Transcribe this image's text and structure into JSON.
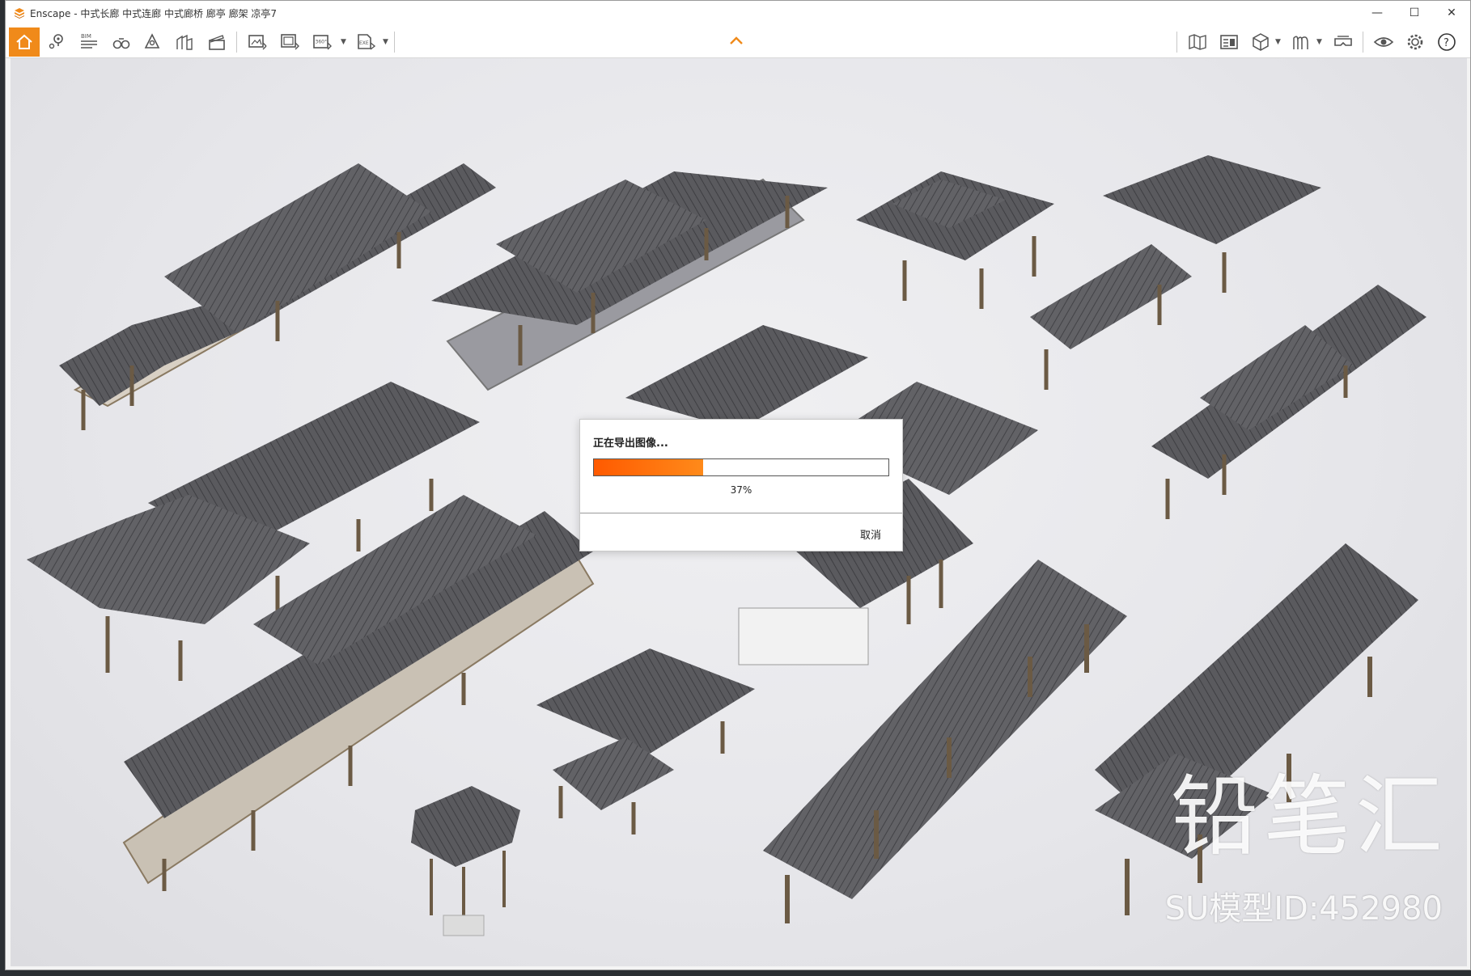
{
  "window": {
    "title": "Enscape - 中式长廊 中式连廊 中式廊桥 廊亭 廊架 凉亭7",
    "controls": {
      "minimize": "—",
      "maximize": "☐",
      "close": "✕"
    }
  },
  "toolbar": {
    "bim_label": "BIM",
    "pano_label": "360°",
    "exe_label": "EXE",
    "help_label": "?",
    "accent_color": "#f08a1a"
  },
  "dialog": {
    "title": "正在导出图像...",
    "progress_percent": 37,
    "percent_label": "37%",
    "cancel_label": "取消"
  },
  "watermark": {
    "brand": "铅笔汇",
    "model_id": "SU模型ID:452980"
  }
}
